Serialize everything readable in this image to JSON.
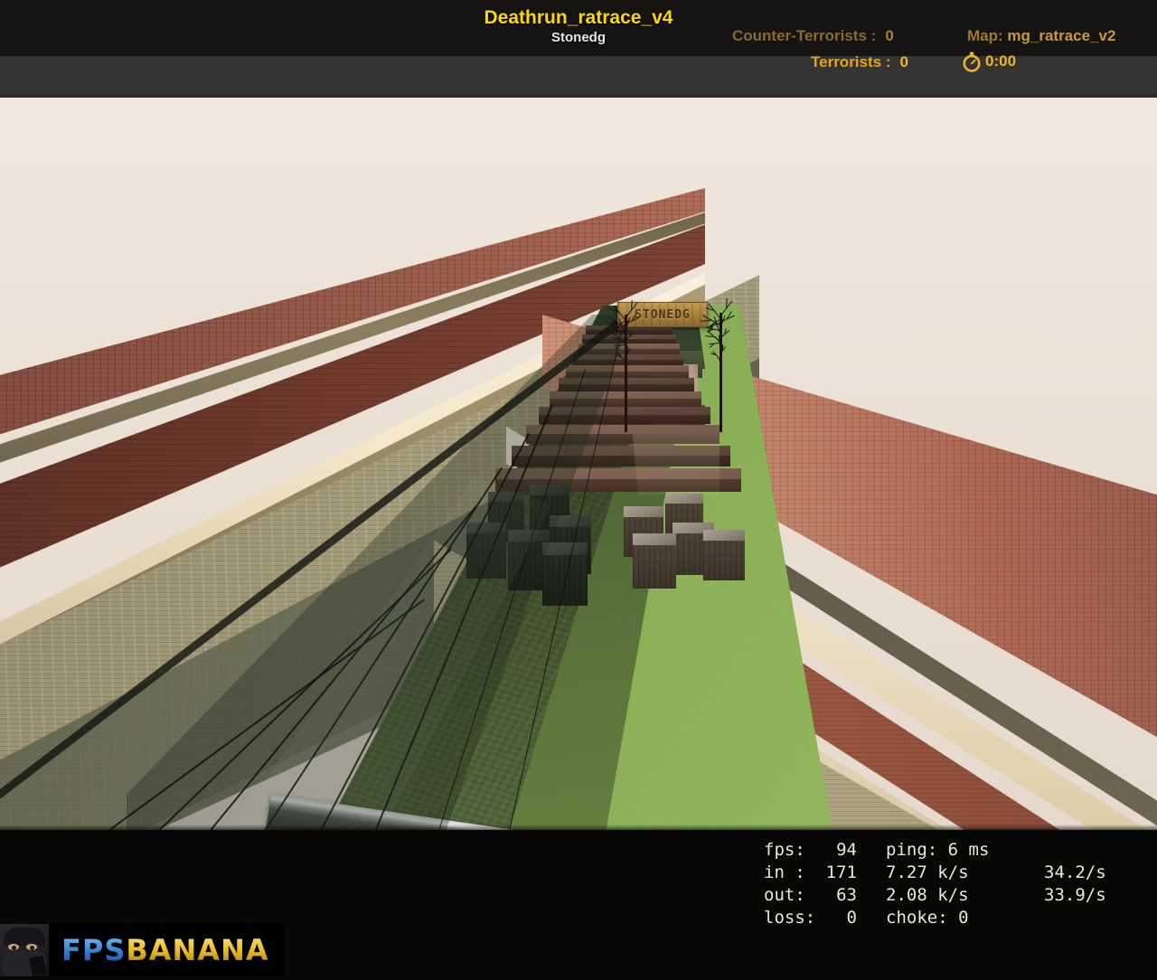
{
  "header": {
    "map_title": "Deathrun_ratrace_v4",
    "map_author": "Stonedg",
    "ct_label": "Counter-Terrorists :",
    "ct_score": "0",
    "t_label": "Terrorists :",
    "t_score": "0",
    "map_label": "Map:",
    "map_name": "mg_ratrace_v2",
    "timer_icon": "stopwatch-icon",
    "timer_value": "0:00",
    "colors": {
      "title": "#FFD700",
      "author": "#e8e8e8",
      "ct": "#8a6a28",
      "t": "#e8a317",
      "map": "#c49a3c",
      "band_top": "#151413",
      "band_bottom": "#353432"
    }
  },
  "scene": {
    "sign_text": "STONEDG",
    "sky_color": "#EDE2D8",
    "grass_color": "#6f8a4b",
    "brick_color": "#8d4f3e",
    "stone_color": "#a79d79",
    "trim_color": "#f3e6c9",
    "glass_tint": "#1e2d1e",
    "beam_color": "#4d524c"
  },
  "netgraph": {
    "rows": [
      {
        "a": "fps:   94",
        "b": "ping: 6 ms",
        "c": ""
      },
      {
        "a": "in :  171",
        "b": "7.27 k/s",
        "c": "34.2/s"
      },
      {
        "a": "out:   63",
        "b": "2.08 k/s",
        "c": "33.9/s"
      },
      {
        "a": "loss:   0",
        "b": "choke: 0",
        "c": ""
      }
    ],
    "text_color": "#ece8d6"
  },
  "watermark": {
    "text_part1": "FPS",
    "text_part2": "BANANA",
    "avatar_icon": "soldier-avatar-icon",
    "color1": "#2f7fd0",
    "color2": "#e8b720"
  }
}
